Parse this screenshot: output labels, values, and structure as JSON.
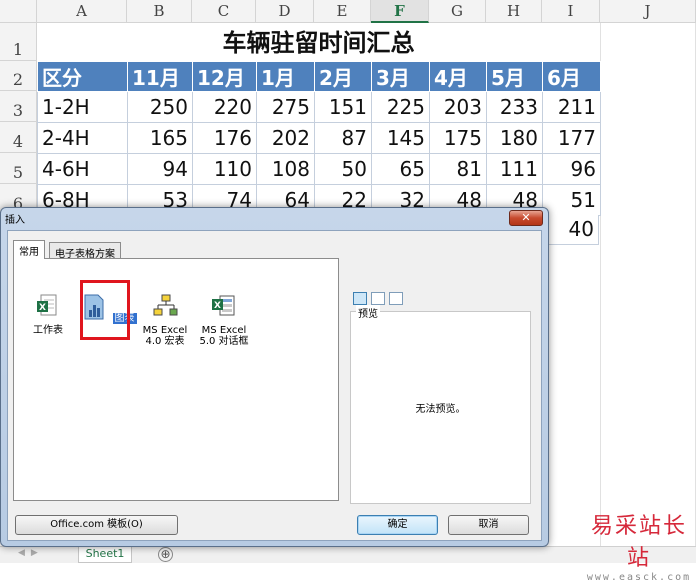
{
  "columns": [
    "A",
    "B",
    "C",
    "D",
    "E",
    "F",
    "G",
    "H",
    "I",
    "J"
  ],
  "selected_column": "F",
  "rows": [
    "1",
    "2",
    "3",
    "4",
    "5",
    "6"
  ],
  "title": "车辆驻留时间汇总",
  "table": {
    "header": [
      "区分",
      "11月",
      "12月",
      "1月",
      "2月",
      "3月",
      "4月",
      "5月",
      "6月"
    ],
    "body": [
      [
        "1-2H",
        "250",
        "220",
        "275",
        "151",
        "225",
        "203",
        "233",
        "211"
      ],
      [
        "2-4H",
        "165",
        "176",
        "202",
        "87",
        "145",
        "175",
        "180",
        "177"
      ],
      [
        "4-6H",
        "94",
        "110",
        "108",
        "50",
        "65",
        "81",
        "111",
        "96"
      ],
      [
        "6-8H",
        "53",
        "74",
        "64",
        "22",
        "32",
        "48",
        "48",
        "51"
      ]
    ],
    "partial_visible": "40"
  },
  "sheet_tabs": {
    "active": "Sheet1",
    "add": "⊕"
  },
  "dialog": {
    "title": "插入",
    "close": "✕",
    "tabs": [
      "常用",
      "电子表格方案"
    ],
    "items": [
      {
        "label": "工作表",
        "icon": "worksheet-icon"
      },
      {
        "label": "图表",
        "icon": "chart-icon"
      },
      {
        "label_1": "MS Excel",
        "label_2": "4.0 宏表",
        "icon": "macro-sheet-icon"
      },
      {
        "label_1": "MS Excel",
        "label_2": "5.0 对话框",
        "icon": "dialog-sheet-icon"
      }
    ],
    "preview_label": "预览",
    "preview_empty": "无法预览。",
    "buttons": {
      "office": "Office.com 模板(O)",
      "ok": "确定",
      "cancel": "取消"
    }
  },
  "watermark": {
    "main": "易采站长站",
    "sub": "www.easck.com"
  },
  "colors": {
    "header_blue": "#4f81bd",
    "excel_green": "#217346",
    "highlight_red": "#e0161e"
  }
}
